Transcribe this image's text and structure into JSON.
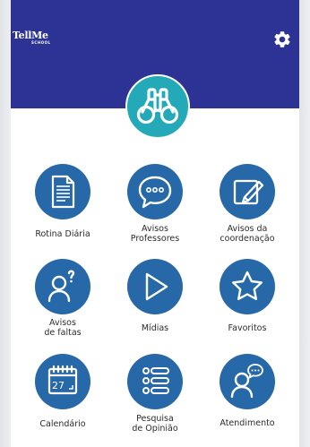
{
  "app": {
    "logo_text": "TellMe",
    "logo_sub": "SCHOOL"
  },
  "header": {
    "background": "#2d3394",
    "settings_icon": "gear-icon",
    "hero_icon": "binoculars-icon",
    "hero_color": "#23a9b8"
  },
  "menu": {
    "accent": "#2769a8",
    "items": [
      {
        "label": "Rotina Diária",
        "icon": "document-icon"
      },
      {
        "label": "Avisos\nProfessores",
        "icon": "chat-bubble-icon"
      },
      {
        "label": "Avisos da\ncoordenação",
        "icon": "edit-note-icon"
      },
      {
        "label": "Avisos\nde faltas",
        "icon": "person-question-icon"
      },
      {
        "label": "Mídias",
        "icon": "play-icon"
      },
      {
        "label": "Favoritos",
        "icon": "star-icon"
      },
      {
        "label": "Calendário",
        "icon": "calendar-icon",
        "calendar_day": "27"
      },
      {
        "label": "Pesquisa\nde Opinião",
        "icon": "survey-list-icon"
      },
      {
        "label": "Atendimento",
        "icon": "person-chat-icon"
      }
    ]
  }
}
